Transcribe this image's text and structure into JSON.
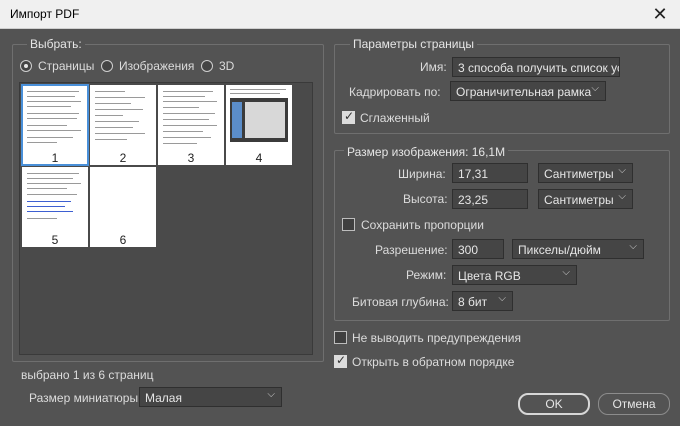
{
  "window": {
    "title": "Импорт PDF",
    "close_glyph": "✕"
  },
  "select_panel": {
    "title": "Выбрать:",
    "radios": [
      {
        "label": "Страницы",
        "selected": true
      },
      {
        "label": "Изображения",
        "selected": false
      },
      {
        "label": "3D",
        "selected": false
      }
    ],
    "thumbnails": [
      {
        "number": "1",
        "selected": true
      },
      {
        "number": "2",
        "selected": false
      },
      {
        "number": "3",
        "selected": false
      },
      {
        "number": "4",
        "selected": false
      },
      {
        "number": "5",
        "selected": false
      },
      {
        "number": "6",
        "selected": false
      }
    ],
    "status": "выбрано 1 из 6 страниц",
    "thumb_size_label": "Размер миниатюры:",
    "thumb_size_value": "Малая"
  },
  "page_options": {
    "title": "Параметры страницы",
    "name_label": "Имя:",
    "name_value": "3 способа получить список уст",
    "crop_label": "Кадрировать по:",
    "crop_value": "Ограничительная рамка",
    "antialias_label": "Сглаженный",
    "antialias_checked": true
  },
  "image_size": {
    "title": "Размер изображения: 16,1M",
    "width_label": "Ширина:",
    "width_value": "17,31",
    "width_unit": "Сантиметры",
    "height_label": "Высота:",
    "height_value": "23,25",
    "height_unit": "Сантиметры",
    "constrain_label": "Сохранить пропорции",
    "constrain_checked": false,
    "resolution_label": "Разрешение:",
    "resolution_value": "300",
    "resolution_unit": "Пикселы/дюйм",
    "mode_label": "Режим:",
    "mode_value": "Цвета RGB",
    "depth_label": "Битовая глубина:",
    "depth_value": "8 бит"
  },
  "options": {
    "suppress_warnings_label": "Не выводить предупреждения",
    "suppress_warnings_checked": false,
    "reverse_order_label": "Открыть в обратном порядке",
    "reverse_order_checked": true
  },
  "buttons": {
    "ok": "OK",
    "cancel": "Отмена"
  }
}
